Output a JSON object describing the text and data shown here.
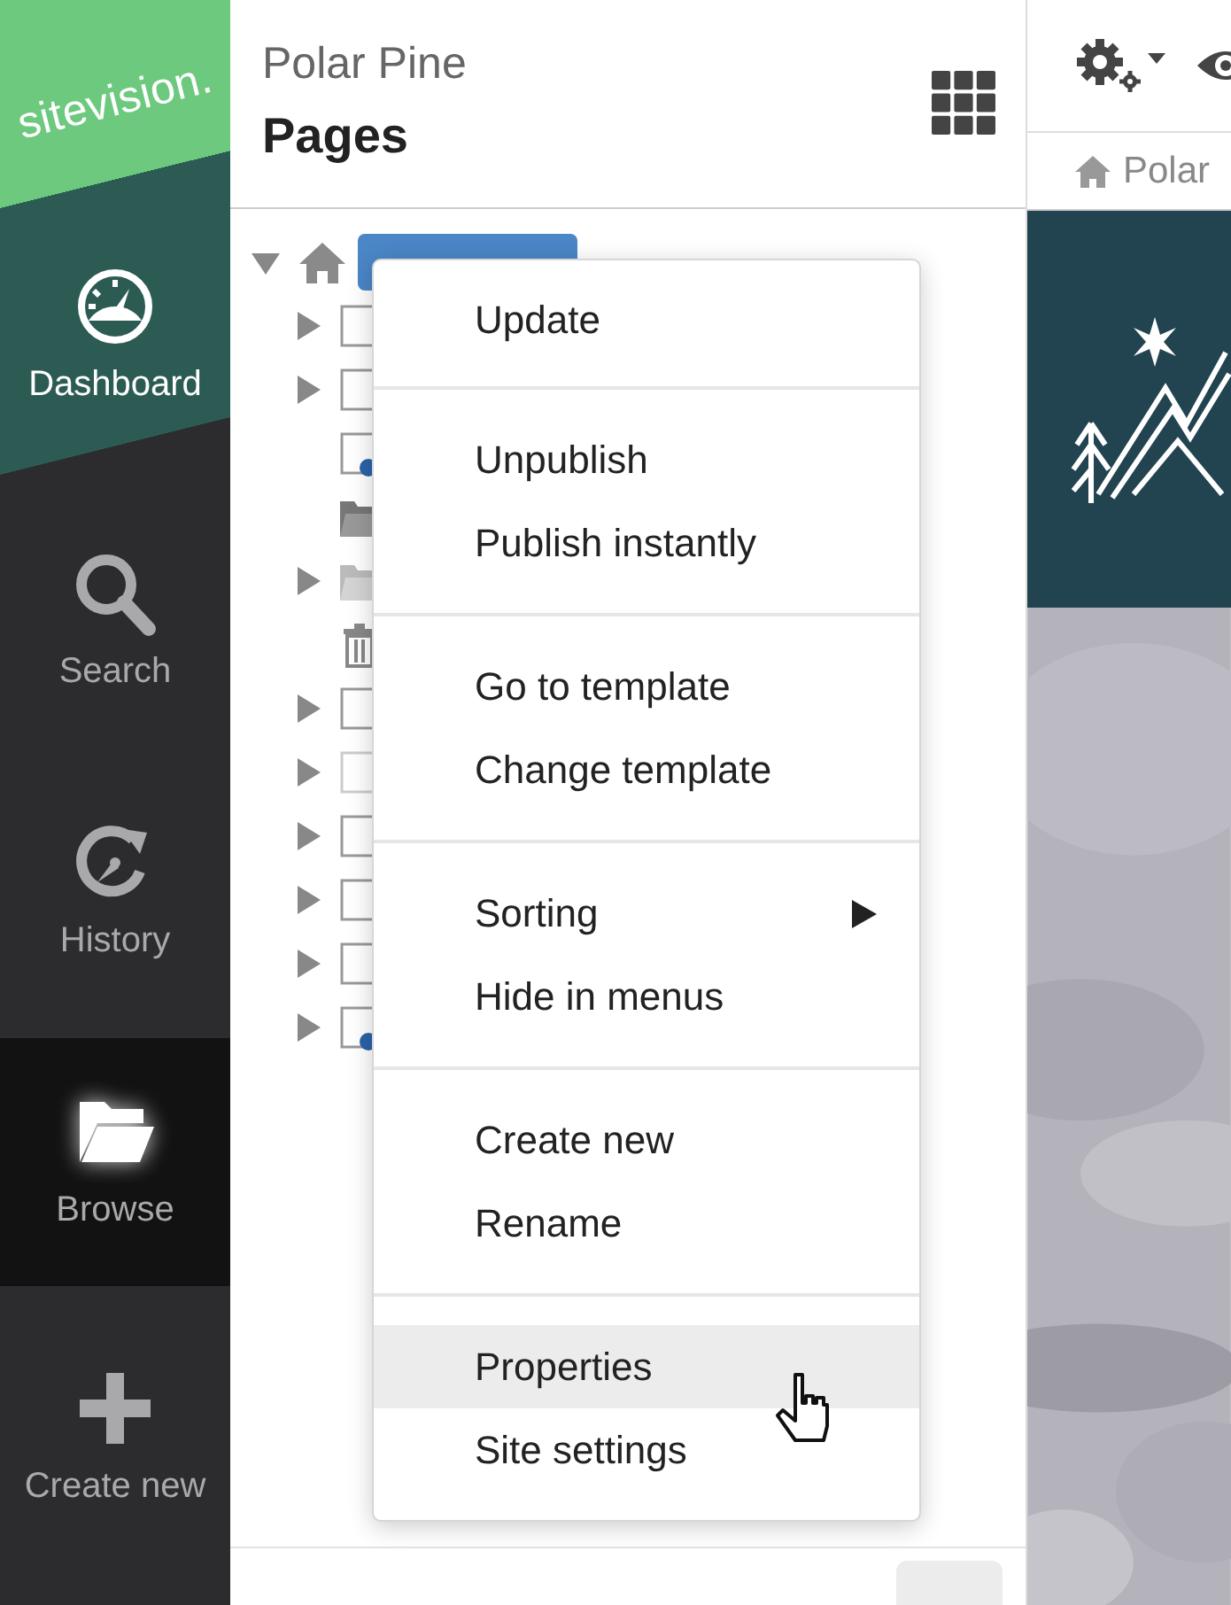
{
  "sidebar": {
    "logo": "sitevision.",
    "items": [
      {
        "label": "Dashboard",
        "kind": "dashboard",
        "selected": false
      },
      {
        "label": "Search",
        "kind": "search",
        "selected": false
      },
      {
        "label": "History",
        "kind": "history",
        "selected": false
      },
      {
        "label": "Browse",
        "kind": "browse",
        "selected": true
      },
      {
        "label": "Create new",
        "kind": "create",
        "selected": false
      }
    ]
  },
  "pages_panel": {
    "site": "Polar Pine",
    "title": "Pages",
    "tree": {
      "expanded": true,
      "selected": true,
      "children": [
        {
          "kind": "page",
          "expanded": false
        },
        {
          "kind": "page",
          "expanded": false
        },
        {
          "kind": "published-page"
        },
        {
          "kind": "folder"
        },
        {
          "kind": "light-folder",
          "expanded": false
        },
        {
          "kind": "trash"
        },
        {
          "kind": "page",
          "expanded": false
        },
        {
          "kind": "light-page",
          "expanded": false
        },
        {
          "kind": "page",
          "expanded": false
        },
        {
          "kind": "page",
          "expanded": false
        },
        {
          "kind": "page",
          "expanded": false
        },
        {
          "kind": "published-page",
          "expanded": false
        }
      ]
    }
  },
  "context_menu": {
    "groups": [
      [
        {
          "label": "Update",
          "selected": false
        }
      ],
      [
        {
          "label": "Unpublish",
          "selected": false
        },
        {
          "label": "Publish instantly",
          "selected": false
        }
      ],
      [
        {
          "label": "Go to template",
          "selected": false
        },
        {
          "label": "Change template",
          "selected": false
        }
      ],
      [
        {
          "label": "Sorting",
          "selected": false,
          "submenu": true
        },
        {
          "label": "Hide in menus",
          "selected": false
        }
      ],
      [
        {
          "label": "Create new",
          "selected": false
        },
        {
          "label": "Rename",
          "selected": false
        }
      ],
      [
        {
          "label": "Properties",
          "selected": true
        },
        {
          "label": "Site settings",
          "selected": false
        }
      ]
    ]
  },
  "preview": {
    "breadcrumb": "Polar"
  }
}
